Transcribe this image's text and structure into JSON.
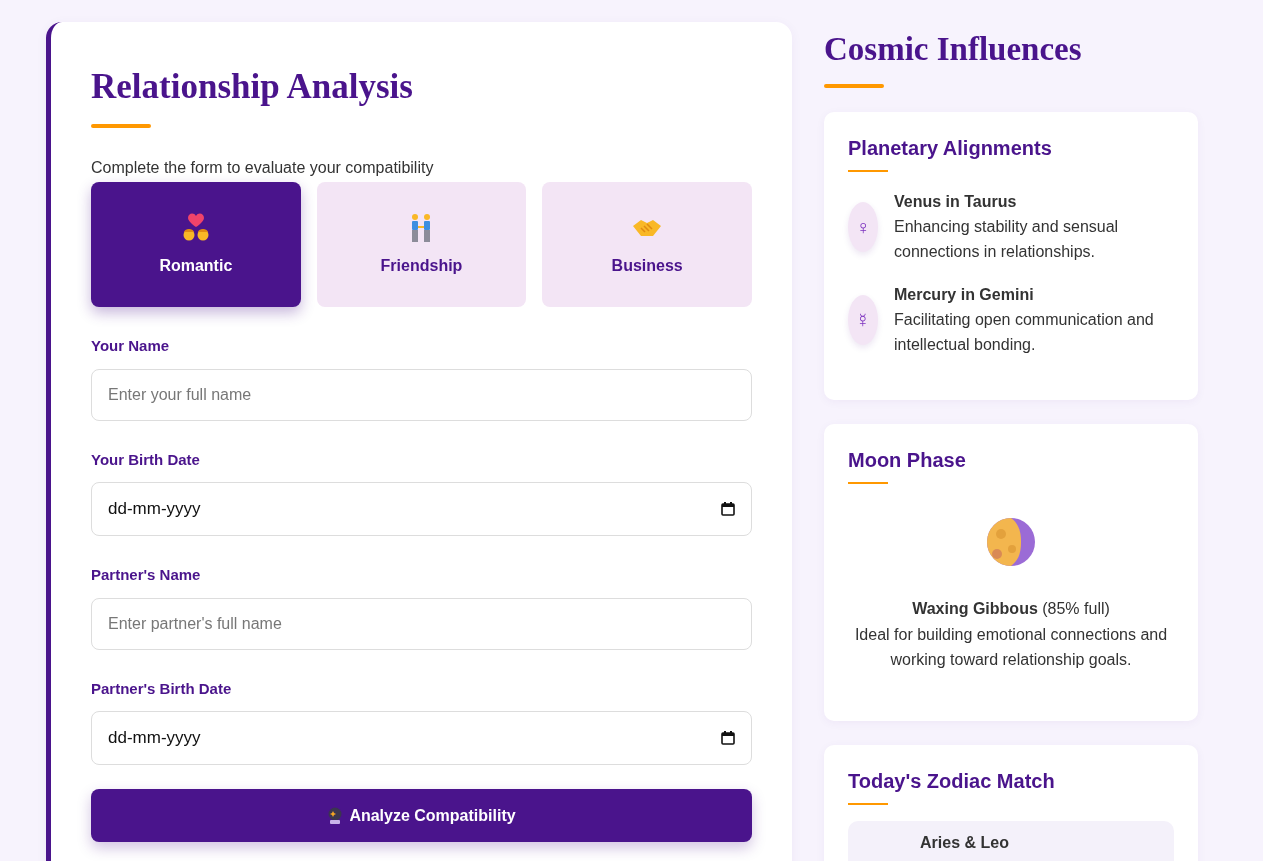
{
  "form": {
    "title": "Relationship Analysis",
    "subtitle": "Complete the form to evaluate your compatibility",
    "types": [
      {
        "label": "Romantic",
        "kind": "romantic",
        "selected": true
      },
      {
        "label": "Friendship",
        "kind": "friendship",
        "selected": false
      },
      {
        "label": "Business",
        "kind": "business",
        "selected": false
      }
    ],
    "fields": [
      {
        "label": "Your Name",
        "kind": "text",
        "placeholder": "Enter your full name"
      },
      {
        "label": "Your Birth Date",
        "kind": "date",
        "placeholder": "dd-mm-yyyy"
      },
      {
        "label": "Partner's Name",
        "kind": "text",
        "placeholder": "Enter partner's full name"
      },
      {
        "label": "Partner's Birth Date",
        "kind": "date",
        "placeholder": "dd-mm-yyyy"
      }
    ],
    "submit": "Analyze Compatibility"
  },
  "sidebar": {
    "title": "Cosmic Influences",
    "planetary": {
      "title": "Planetary Alignments",
      "items": [
        {
          "symbol": "♀",
          "name": "Venus in Taurus",
          "text": "Enhancing stability and sensual connections in relationships."
        },
        {
          "symbol": "☿",
          "name": "Mercury in Gemini",
          "text": "Facilitating open communication and intellectual bonding."
        }
      ]
    },
    "moon": {
      "title": "Moon Phase",
      "phase": "**Waxing Gibbous** (85% full)",
      "text": "Ideal for building emotional connections and working toward relationship goals."
    },
    "zodiac": {
      "title": "Today's Zodiac Match",
      "match": "Aries & Leo"
    }
  }
}
